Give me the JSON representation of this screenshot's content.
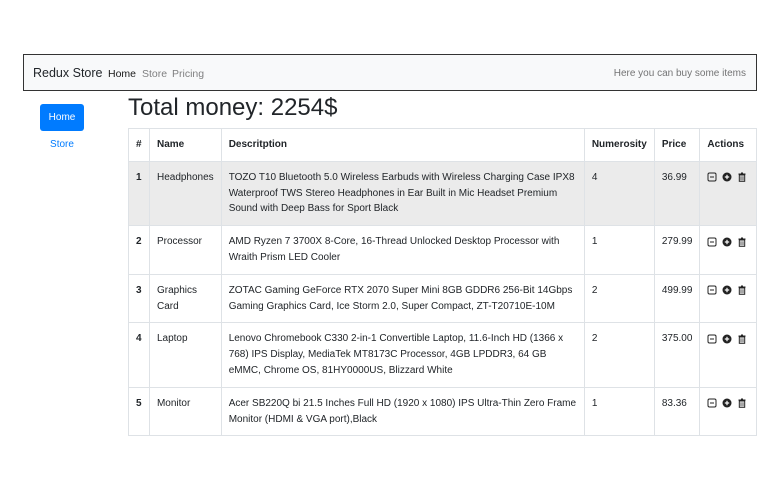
{
  "navbar": {
    "brand": "Redux Store",
    "links": [
      "Home",
      "Store",
      "Pricing"
    ],
    "right_text": "Here you can buy some items"
  },
  "sidebar": {
    "home_label": "Home",
    "store_label": "Store"
  },
  "main": {
    "total": "Total money: 2254$"
  },
  "table": {
    "headers": [
      "#",
      "Name",
      "Descritption",
      "Numerosity",
      "Price",
      "Actions"
    ],
    "rows": [
      {
        "id": "1",
        "name": "Headphones",
        "desc": "TOZO T10 Bluetooth 5.0 Wireless Earbuds with Wireless Charging Case IPX8 Waterproof TWS Stereo Headphones in Ear Built in Mic Headset Premium Sound with Deep Bass for Sport Black",
        "num": "4",
        "price": "36.99"
      },
      {
        "id": "2",
        "name": "Processor",
        "desc": "AMD Ryzen 7 3700X 8-Core, 16-Thread Unlocked Desktop Processor with Wraith Prism LED Cooler",
        "num": "1",
        "price": "279.99"
      },
      {
        "id": "3",
        "name": "Graphics Card",
        "desc": "ZOTAC Gaming GeForce RTX 2070 Super Mini 8GB GDDR6 256-Bit 14Gbps Gaming Graphics Card, Ice Storm 2.0, Super Compact, ZT-T20710E-10M",
        "num": "2",
        "price": "499.99"
      },
      {
        "id": "4",
        "name": "Laptop",
        "desc": "Lenovo Chromebook C330 2-in-1 Convertible Laptop, 11.6-Inch HD (1366 x 768) IPS Display, MediaTek MT8173C Processor, 4GB LPDDR3, 64 GB eMMC, Chrome OS, 81HY0000US, Blizzard White",
        "num": "2",
        "price": "375.00"
      },
      {
        "id": "5",
        "name": "Monitor",
        "desc": "Acer SB220Q bi 21.5 Inches Full HD (1920 x 1080) IPS Ultra-Thin Zero Frame Monitor (HDMI & VGA port),Black",
        "num": "1",
        "price": "83.36"
      }
    ],
    "action_icons": [
      "minus-square-icon",
      "plus-circle-icon",
      "trash-icon"
    ],
    "highlight_color": "#ebebeb"
  },
  "colors": {
    "primary": "#007bff"
  }
}
